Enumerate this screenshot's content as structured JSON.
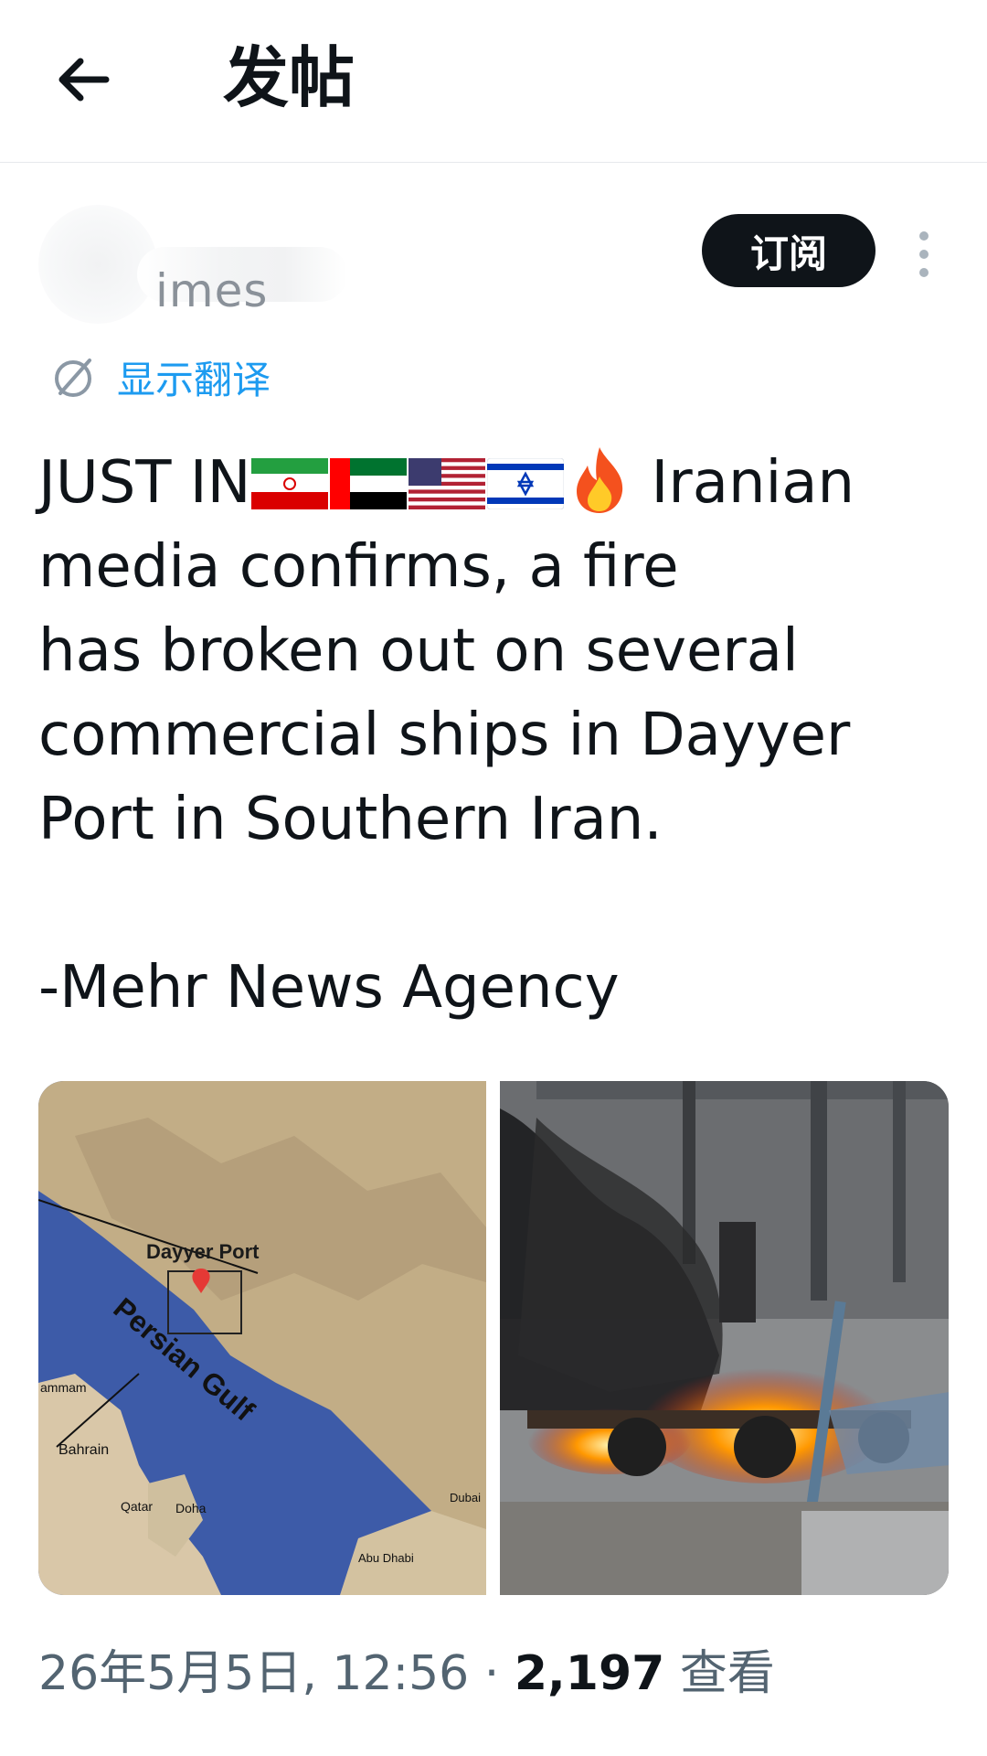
{
  "header": {
    "title": "发帖",
    "back_icon": "arrow-left-icon"
  },
  "author": {
    "name_visible": "imes",
    "subscribe_label": "订阅",
    "more_icon": "more-vertical-icon"
  },
  "translate": {
    "label": "显示翻译",
    "icon": "globe-slash-icon"
  },
  "post": {
    "line1_prefix": "JUST IN",
    "line1_suffix": "Iranian",
    "body": "media confirms, a fire\nhas broken out on several\ncommercial ships in Dayyer\nPort in Southern Iran.\n\n-Mehr News Agency",
    "emojis": [
      "flag-iran-icon",
      "flag-uae-icon",
      "flag-usa-icon",
      "flag-israel-icon",
      "fire-icon"
    ]
  },
  "media": {
    "map": {
      "port_label": "Dayyer Port",
      "gulf_label": "Persian Gulf",
      "bahrain_label": "Bahrain",
      "qatar_label": "Qatar",
      "doha_label": "Doha",
      "dubai_label": "Dubai",
      "abudhabi_label": "Abu Dhabi",
      "dammam_label": "ammam"
    },
    "photo": {
      "subject": "burning-vehicle-photo"
    }
  },
  "meta": {
    "date": "26年5月5日, 12:56 · ",
    "views_count": "2,197",
    "views_label": " 查看"
  },
  "colors": {
    "accent": "#1d9bf0",
    "text": "#0f1419",
    "muted": "#536471",
    "button": "#0f1419"
  }
}
